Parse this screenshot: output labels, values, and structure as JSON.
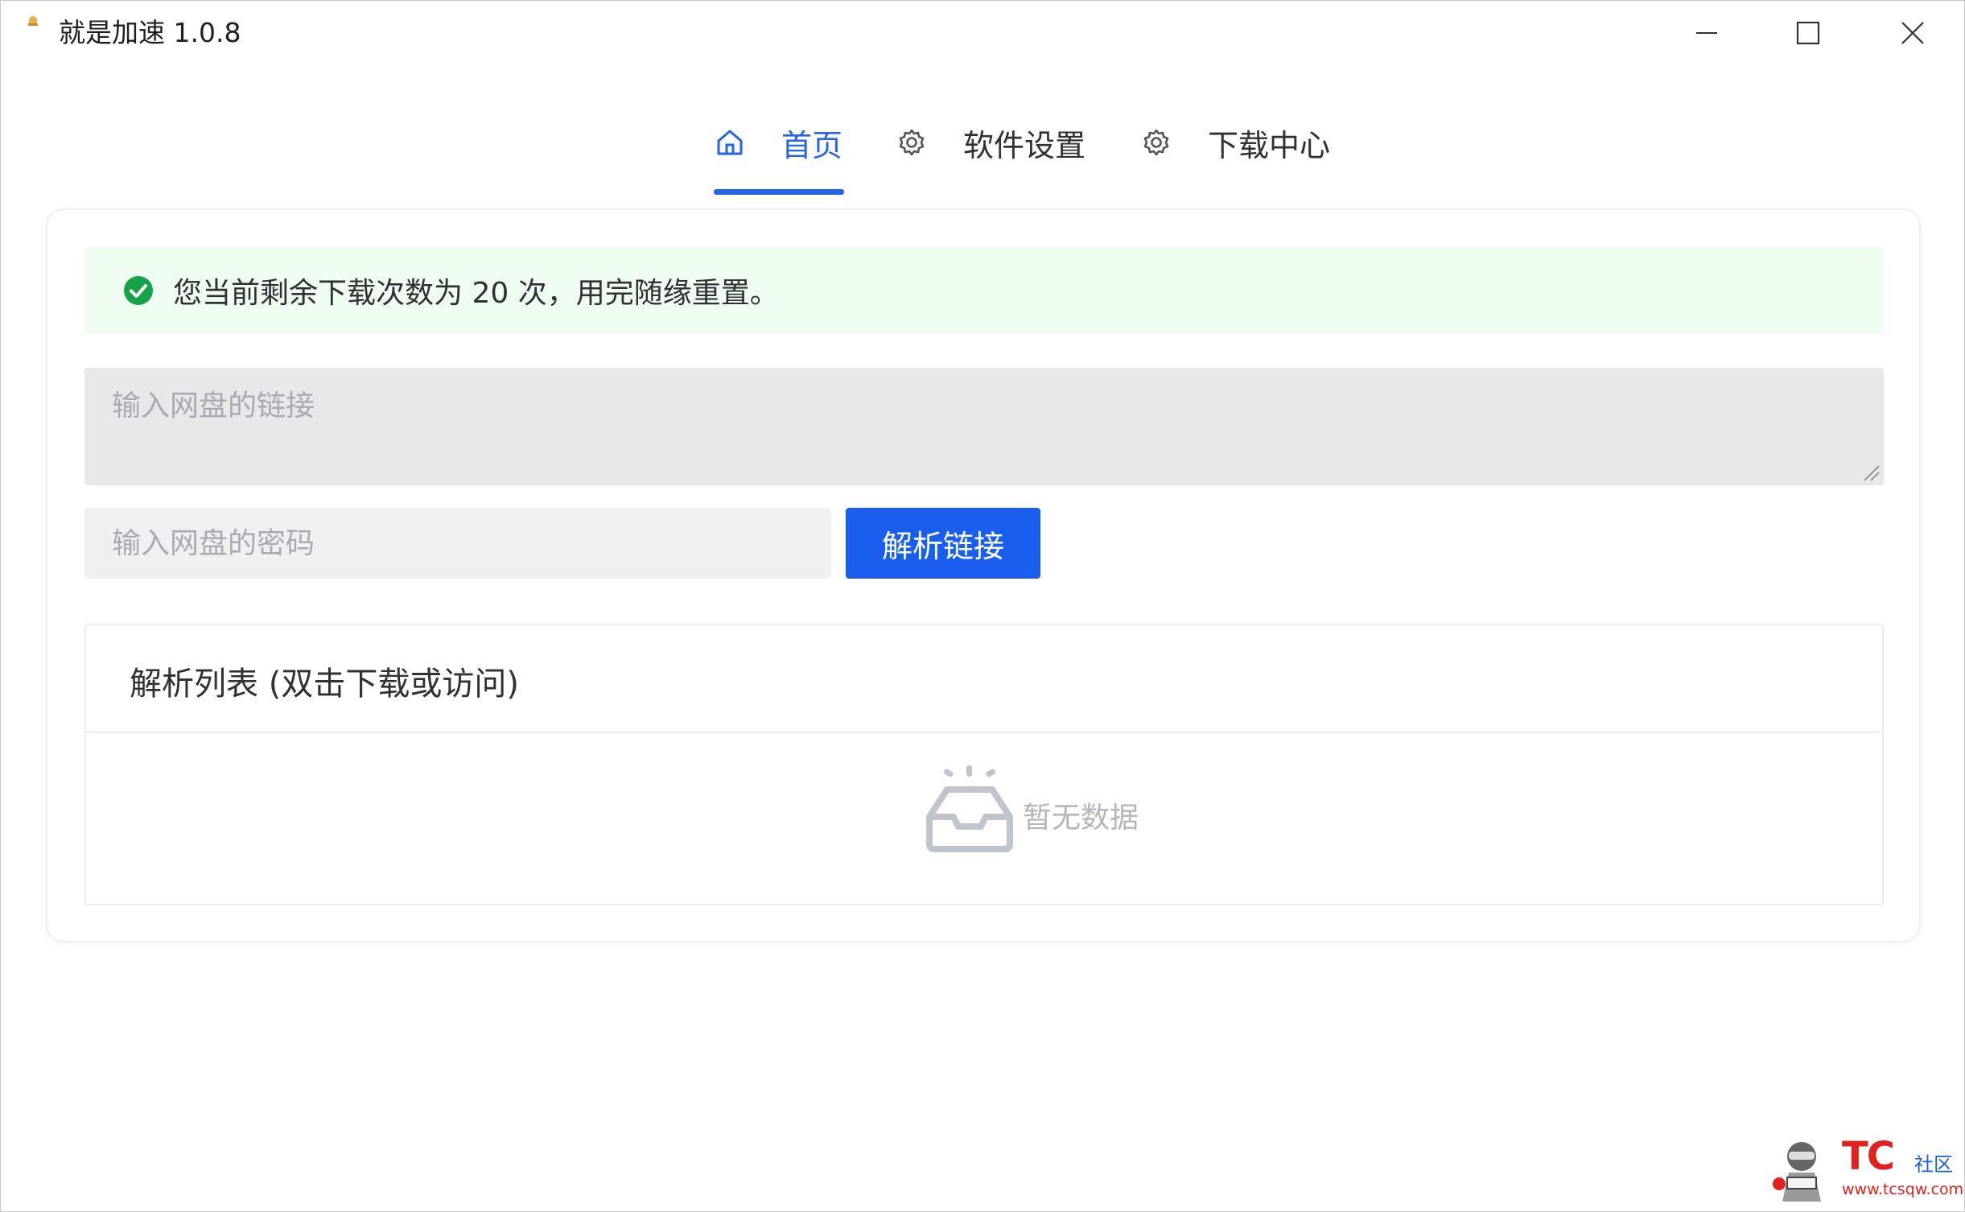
{
  "window": {
    "title": "就是加速  1.0.8",
    "controls": [
      "minimize",
      "maximize",
      "close"
    ]
  },
  "tabs": [
    {
      "label": "首页",
      "icon": "home-icon",
      "active": true
    },
    {
      "label": "软件设置",
      "icon": "gear-icon",
      "active": false
    },
    {
      "label": "下载中心",
      "icon": "gear-icon",
      "active": false
    }
  ],
  "alert": {
    "icon": "check-circle-icon",
    "text": "您当前剩余下载次数为 20 次，用完随缘重置。"
  },
  "form": {
    "link_placeholder": "输入网盘的链接",
    "link_value": "",
    "password_placeholder": "输入网盘的密码",
    "password_value": "",
    "parse_button": "解析链接"
  },
  "list": {
    "title": "解析列表 (双击下载或访问)",
    "empty_text": "暂无数据",
    "empty_icon": "empty-inbox-icon"
  },
  "watermark": {
    "brand": "TC",
    "suffix": "社区",
    "url": "www.tcsqw.com"
  },
  "colors": {
    "accent": "#2563eb",
    "button": "#1a5ef0",
    "success": "#16a34a",
    "alert_bg": "#effef0"
  }
}
